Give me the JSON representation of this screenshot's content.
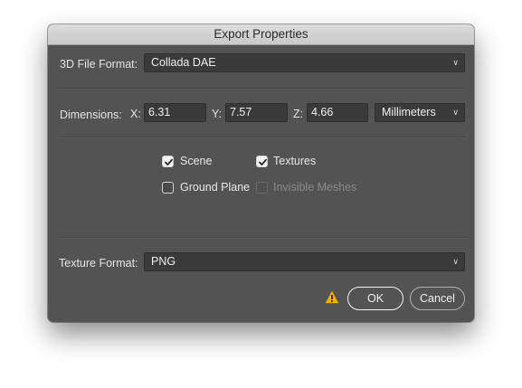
{
  "dialog": {
    "title": "Export Properties"
  },
  "file_format": {
    "label": "3D File Format:",
    "value": "Collada DAE",
    "icon": "chevron-down-icon"
  },
  "dimensions": {
    "label": "Dimensions:",
    "x_label": "X:",
    "x_value": "6.31",
    "y_label": "Y:",
    "y_value": "7.57",
    "z_label": "Z:",
    "z_value": "4.66",
    "units": "Millimeters"
  },
  "options": {
    "scene": {
      "label": "Scene",
      "checked": true
    },
    "textures": {
      "label": "Textures",
      "checked": true
    },
    "ground_plane": {
      "label": "Ground Plane",
      "checked": false
    },
    "invisible_meshes": {
      "label": "Invisible Meshes",
      "checked": false,
      "disabled": true
    }
  },
  "texture_format": {
    "label": "Texture Format:",
    "value": "PNG"
  },
  "footer": {
    "warning_icon": "warning-icon",
    "ok_label": "OK",
    "cancel_label": "Cancel"
  },
  "colors": {
    "dialog_bg": "#535353",
    "field_bg": "#3a3a3a",
    "warning": "#f2b200"
  }
}
